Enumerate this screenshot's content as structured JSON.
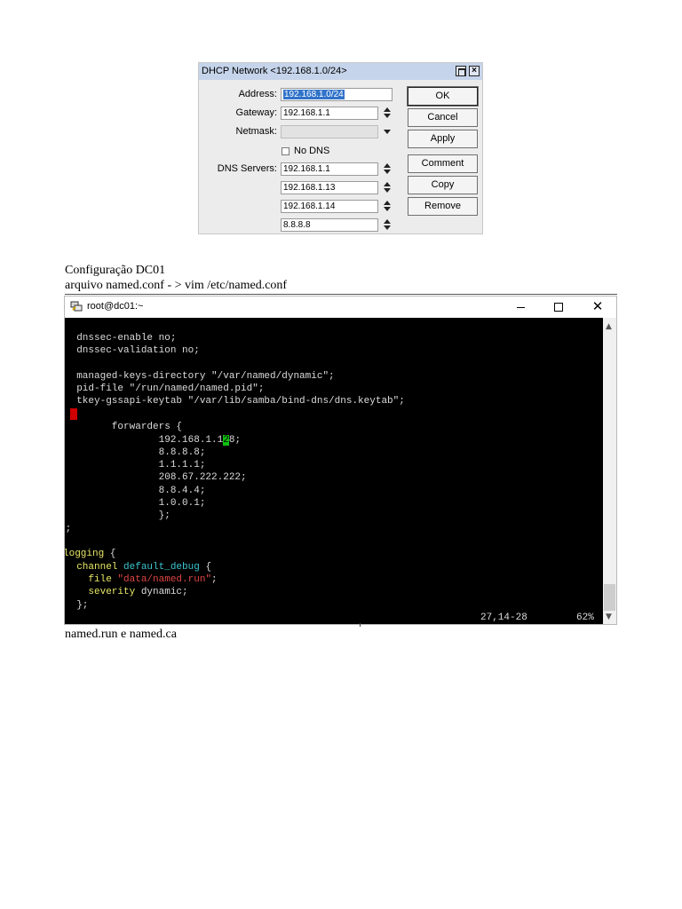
{
  "dhcp": {
    "title": "DHCP Network <192.168.1.0/24>",
    "fields": {
      "address_label": "Address:",
      "address_value": "192.168.1.0/24",
      "gateway_label": "Gateway:",
      "gateway_value": "192.168.1.1",
      "netmask_label": "Netmask:",
      "netmask_value": "",
      "no_dns_label": "No DNS",
      "dns_label": "DNS Servers:",
      "dns_servers": [
        "192.168.1.1",
        "192.168.1.13",
        "192.168.1.14",
        "8.8.8.8"
      ]
    },
    "buttons": {
      "ok": "OK",
      "cancel": "Cancel",
      "apply": "Apply",
      "comment": "Comment",
      "copy": "Copy",
      "remove": "Remove"
    }
  },
  "text": {
    "heading": "Configuração DC01",
    "subheading": "arquivo named.conf - > vim /etc/named.conf",
    "footer": "named.run e named.ca"
  },
  "terminal": {
    "title": "root@dc01:~",
    "lines": {
      "l1": "  dnssec-enable no;",
      "l2": "  dnssec-validation no;",
      "l3": "  managed-keys-directory \"/var/named/dynamic\";",
      "l4": "  pid-file \"/run/named/named.pid\";",
      "l5": "  tkey-gssapi-keytab \"/var/lib/samba/bind-dns/dns.keytab\";",
      "l6": "        forwarders {",
      "l7a": "                192.168.1.1",
      "l7cur": "2",
      "l7b": "8;",
      "l8": "                8.8.8.8;",
      "l9": "                1.1.1.1;",
      "l10": "                208.67.222.222;",
      "l11": "                8.8.4.4;",
      "l12": "                1.0.0.1;",
      "l13": "                };",
      "l14": "};",
      "l15a": "logging",
      "l15b": " {",
      "l16a": "  channel ",
      "l16b": "default_debug",
      "l16c": " {",
      "l17a": "    file ",
      "l17b": "\"data/named.run\"",
      "l17c": ";",
      "l18a": "    severity ",
      "l18b": "dynamic;",
      "l19": "  };"
    },
    "status_pos": "27,14-28",
    "status_pct": "62%"
  }
}
